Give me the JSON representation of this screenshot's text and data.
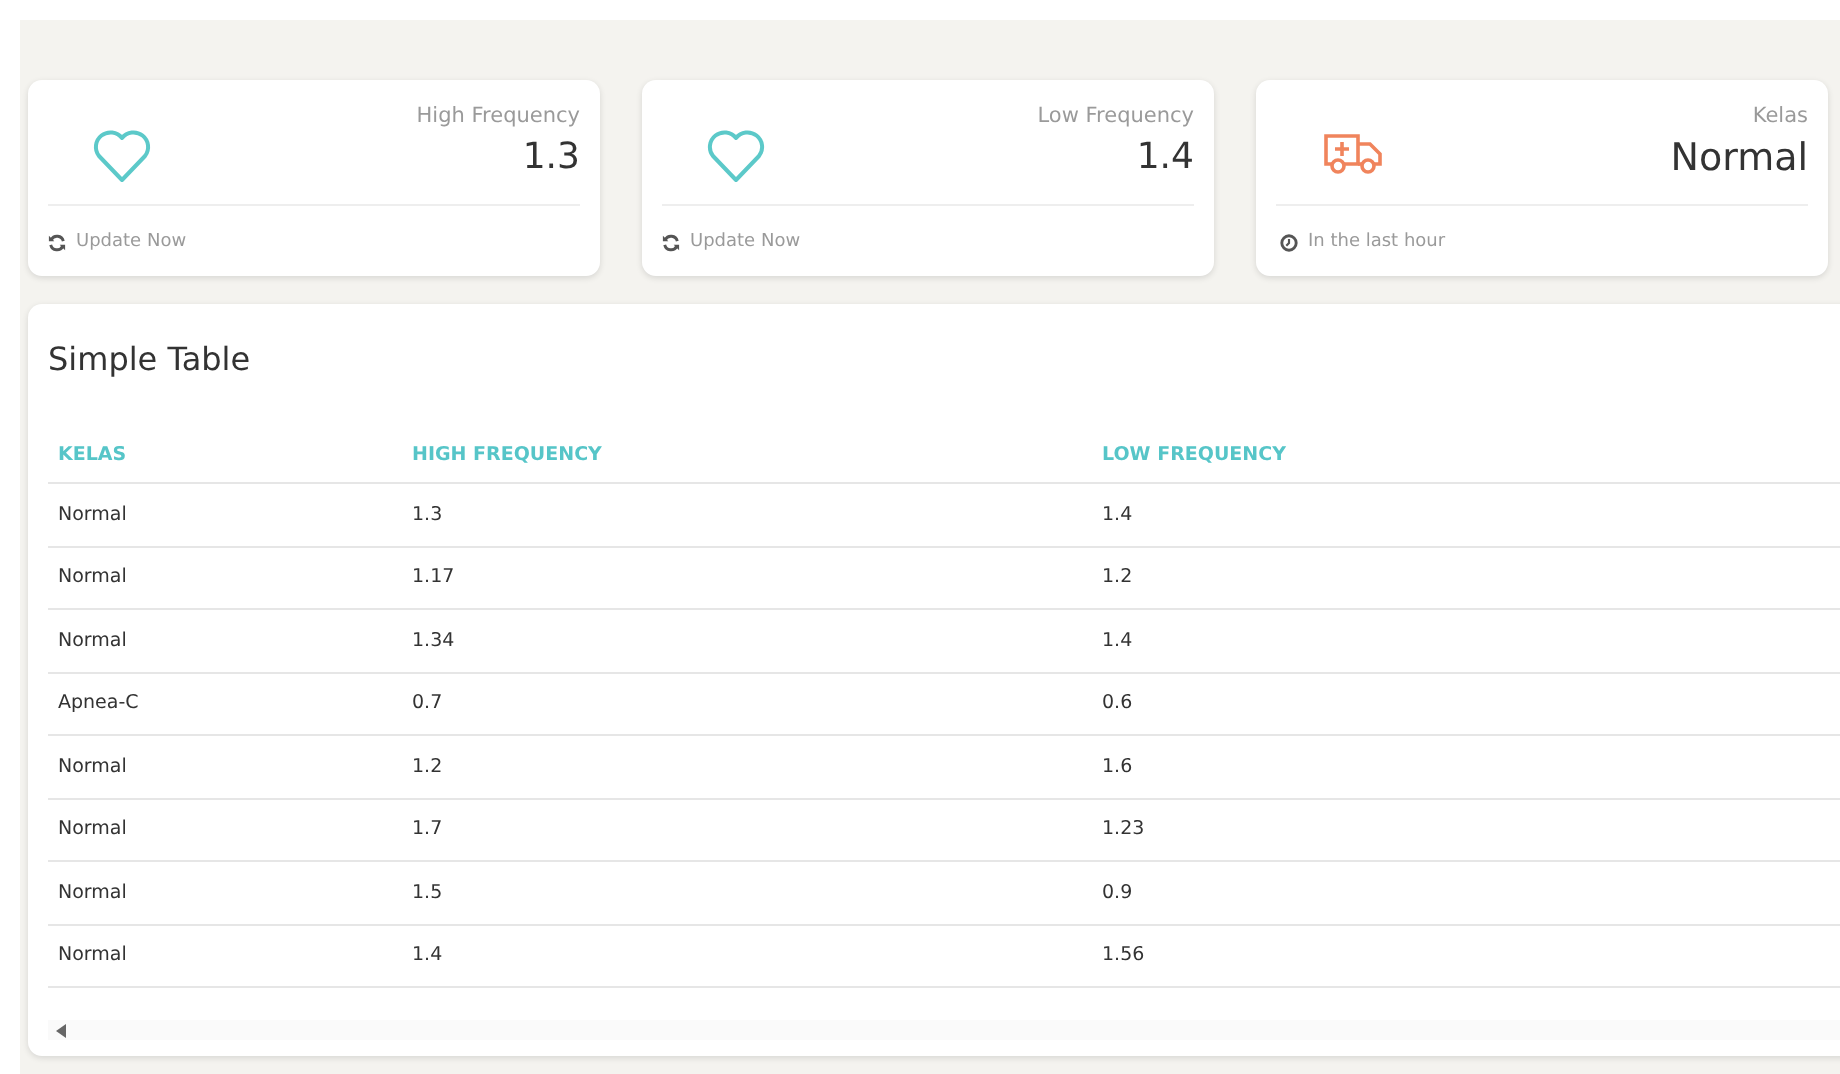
{
  "cards": [
    {
      "kind": "frequency",
      "label": "High Frequency",
      "value": "1.3",
      "footer": "Update Now"
    },
    {
      "kind": "frequency",
      "label": "Low Frequency",
      "value": "1.4",
      "footer": "Update Now"
    },
    {
      "kind": "status",
      "label": "Kelas",
      "value": "Normal",
      "footer": "In the last hour"
    }
  ],
  "table": {
    "title": "Simple Table",
    "columns": [
      "KELAS",
      "HIGH FREQUENCY",
      "LOW FREQUENCY"
    ],
    "rows": [
      [
        "Normal",
        "1.3",
        "1.4"
      ],
      [
        "Normal",
        "1.17",
        "1.2"
      ],
      [
        "Normal",
        "1.34",
        "1.4"
      ],
      [
        "Apnea-C",
        "0.7",
        "0.6"
      ],
      [
        "Normal",
        "1.2",
        "1.6"
      ],
      [
        "Normal",
        "1.7",
        "1.23"
      ],
      [
        "Normal",
        "1.5",
        "0.9"
      ],
      [
        "Normal",
        "1.4",
        "1.56"
      ]
    ]
  }
}
